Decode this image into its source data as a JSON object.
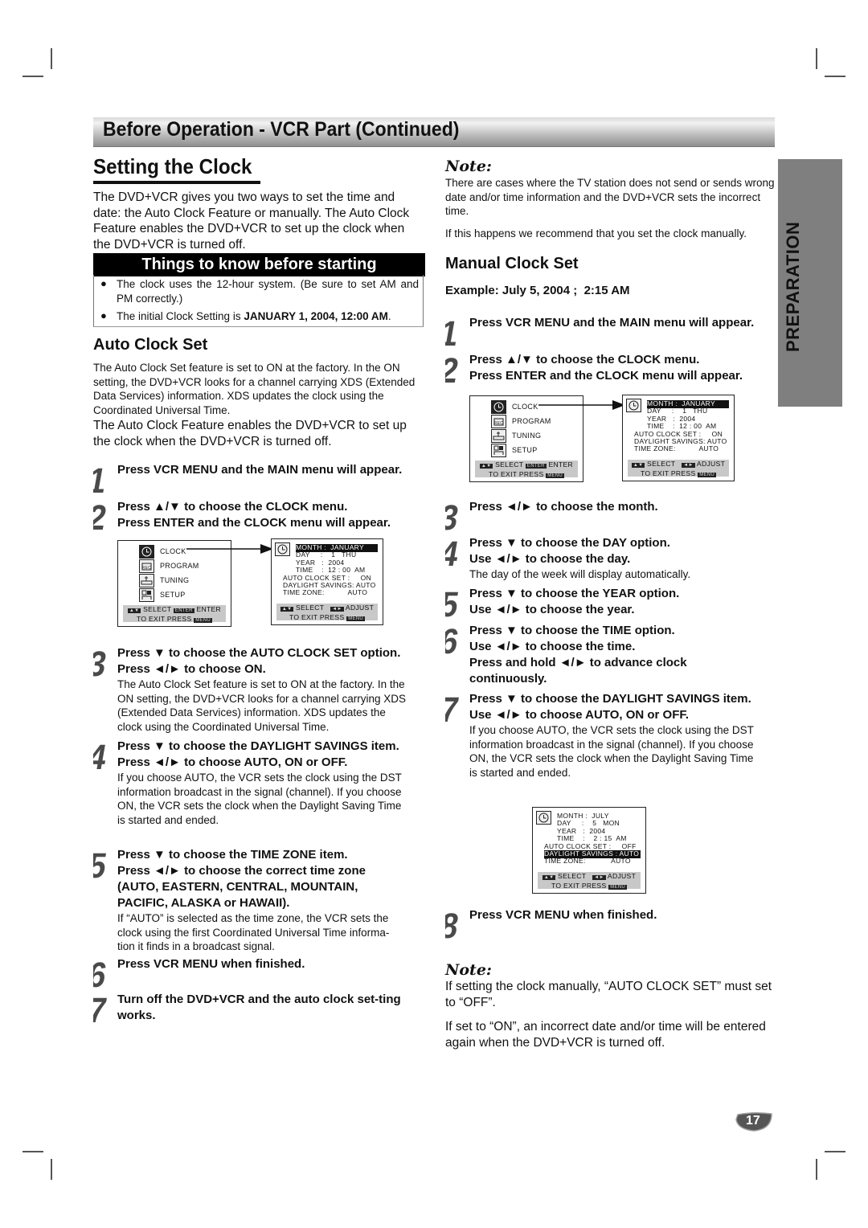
{
  "header": {
    "title": "Before Operation - VCR Part (Continued)"
  },
  "side_tab": {
    "label": "PREPARATION"
  },
  "page_number": "17",
  "left": {
    "title": "Setting the Clock",
    "intro": "The DVD+VCR gives you two ways to set the time and date: the Auto Clock Feature or manually. The Auto Clock Feature enables the DVD+VCR to set up the clock when the DVD+VCR is turned off.",
    "things": {
      "title": "Things to know before starting",
      "bullets": [
        {
          "text": "The clock uses the 12-hour system. (Be sure to set AM and PM correctly.)"
        },
        {
          "text_pre": "The initial Clock Setting is ",
          "text_bold": "JANUARY 1, 2004, 12:00 AM",
          "text_post": "."
        }
      ]
    },
    "auto_clock": {
      "title": "Auto Clock Set",
      "para1": "The Auto Clock Set feature is set to ON at the factory. In the ON setting, the DVD+VCR looks for a channel carrying XDS (Extended Data Services) information. XDS updates the clock using the Coordinated Universal Time.",
      "para2": "The Auto Clock Feature enables the DVD+VCR to set up the clock when the DVD+VCR is turned off."
    },
    "steps": [
      {
        "num": "1",
        "bold": [
          "Press VCR MENU and the MAIN menu will appear."
        ],
        "body": ""
      },
      {
        "num": "2",
        "bold": [
          "Press ▲/▼ to choose the CLOCK menu.",
          "Press ENTER and the CLOCK menu will appear."
        ],
        "body": ""
      },
      {
        "num": "3",
        "bold": [
          "Press ▼ to choose the AUTO CLOCK SET option.",
          "Press ◄/► to choose ON."
        ],
        "body": "The Auto Clock Set feature is set to ON at the factory. In the ON setting, the DVD+VCR looks for a channel carrying XDS (Extended Data Services) information. XDS updates the clock using the Coordinated Universal Time."
      },
      {
        "num": "4",
        "bold": [
          "Press ▼ to choose the DAYLIGHT SAVINGS item.",
          "Press ◄/► to choose AUTO, ON or OFF."
        ],
        "body": "If you choose AUTO, the VCR sets the clock using the DST information broadcast in the signal (channel). If you choose ON, the VCR sets the clock when the Daylight Saving Time is started and ended."
      },
      {
        "num": "5",
        "bold": [
          "Press ▼ to choose the TIME ZONE item.",
          "Press ◄/► to choose the correct time zone (AUTO, EASTERN, CENTRAL, MOUNTAIN, PACIFIC, ALASKA or HAWAII)."
        ],
        "body": "If “AUTO” is selected as the time zone, the VCR sets the clock using the first Coordinated Universal Time informa-tion it finds in a broadcast signal."
      },
      {
        "num": "6",
        "bold": [
          "Press VCR MENU when finished."
        ],
        "body": ""
      },
      {
        "num": "7",
        "bold": [
          "Turn off the DVD+VCR and the auto clock set-ting works."
        ],
        "body": ""
      }
    ]
  },
  "right": {
    "note1": {
      "title": "Note:",
      "para1": "There are cases where the TV station does not send or sends wrong date and/or time information and the DVD+VCR sets the incorrect time.",
      "para2": "If this happens we recommend that you set the clock manually."
    },
    "manual": {
      "title": "Manual Clock Set",
      "example": "Example: July 5, 2004 ;  2:15 AM"
    },
    "steps": [
      {
        "num": "1",
        "bold": [
          "Press VCR MENU and the MAIN menu will appear."
        ],
        "body": ""
      },
      {
        "num": "2",
        "bold": [
          "Press ▲/▼ to choose the CLOCK menu.",
          "Press ENTER and the CLOCK menu will appear."
        ],
        "body": ""
      },
      {
        "num": "3",
        "bold": [
          "Press ◄/► to choose the month."
        ],
        "body": ""
      },
      {
        "num": "4",
        "bold": [
          "Press ▼ to choose the DAY option.",
          "Use ◄/► to choose the day."
        ],
        "body": "The day of the week will display automatically."
      },
      {
        "num": "5",
        "bold": [
          "Press ▼ to choose the YEAR option.",
          "Use ◄/► to choose the year."
        ],
        "body": ""
      },
      {
        "num": "6",
        "bold": [
          "Press ▼ to choose the TIME option.",
          "Use ◄/► to choose the time.",
          "Press and hold ◄/► to advance clock continuously."
        ],
        "body": ""
      },
      {
        "num": "7",
        "bold": [
          "Press ▼ to choose the DAYLIGHT SAVINGS item.",
          "Use ◄/► to choose AUTO, ON or OFF."
        ],
        "body": "If you choose AUTO, the VCR sets the clock using the DST information broadcast in the signal (channel). If you choose ON, the VCR sets the clock when the Daylight Saving Time is started and ended."
      },
      {
        "num": "8",
        "bold": [
          "Press VCR MENU when finished."
        ],
        "body": ""
      }
    ],
    "note2": {
      "title": "Note:",
      "para1": "If setting the clock manually, “AUTO CLOCK SET” must set to “OFF”.",
      "para2": "If set to “ON”, an incorrect date and/or time will be entered again when the DVD+VCR is turned off."
    }
  },
  "osd": {
    "main_menu": {
      "items": [
        {
          "icon": "clock-icon",
          "label": "CLOCK"
        },
        {
          "icon": "program-icon",
          "label": "PROGRAM"
        },
        {
          "icon": "tuning-icon",
          "label": "TUNING"
        },
        {
          "icon": "setup-icon",
          "label": "SETUP"
        }
      ],
      "footer1": "SELECT",
      "footer1_key": "ENTER",
      "footer1_end": "ENTER",
      "footer2": "TO  EXIT PRESS",
      "footer2_key": "MENU"
    },
    "clock_default": {
      "rows": [
        "MONTH :  JANUARY",
        "DAY     :    1   THU",
        "YEAR   :  2004",
        "TIME    :  12 : 00  AM",
        "AUTO CLOCK SET :     ON",
        "DAYLIGHT SAVINGS: AUTO",
        "TIME ZONE:           AUTO"
      ],
      "highlight_row": 0,
      "footer1": "SELECT",
      "footer1_end": "ADJUST",
      "footer2": "TO  EXIT PRESS",
      "footer2_key": "MENU"
    },
    "clock_example": {
      "rows": [
        "MONTH :  JULY",
        "DAY     :    5   MON",
        "YEAR   :  2004",
        "TIME    :    2 : 15  AM",
        "AUTO CLOCK SET :     OFF",
        "DAYLIGHT SAVINGS : AUTO",
        "TIME ZONE:            AUTO"
      ],
      "highlight_row": 5,
      "footer1": "SELECT",
      "footer1_end": "ADJUST",
      "footer2": "TO  EXIT PRESS",
      "footer2_key": "MENU"
    }
  }
}
